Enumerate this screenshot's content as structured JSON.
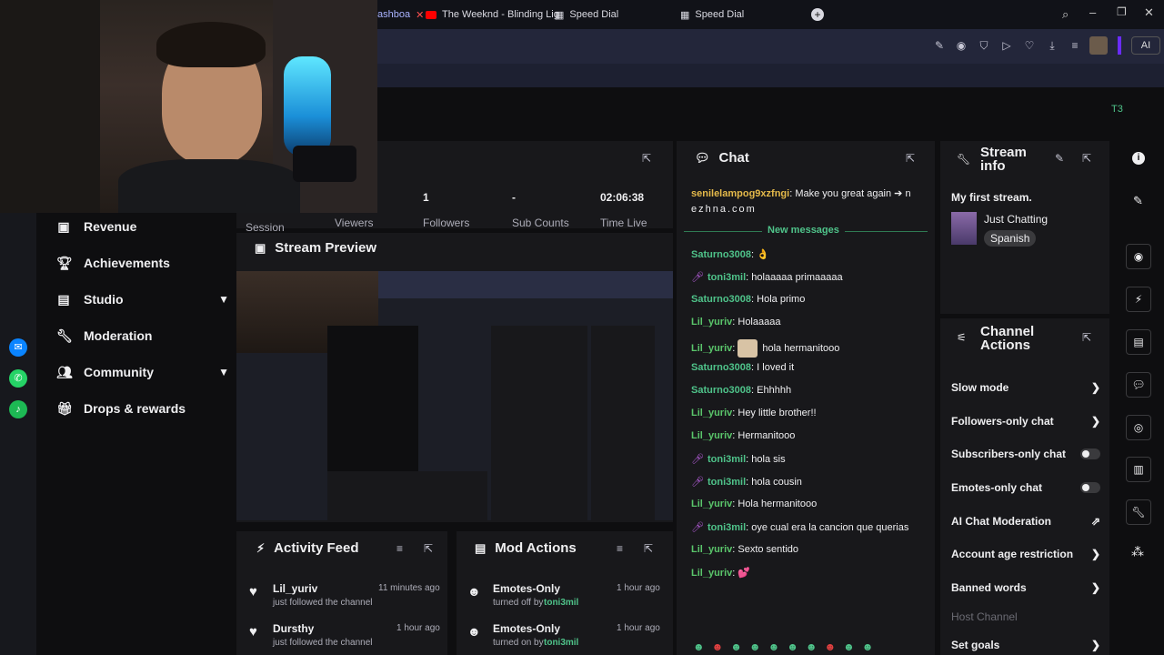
{
  "browser": {
    "tabs": [
      "ashboa",
      "The Weeknd - Blinding Lig",
      "Speed Dial",
      "Speed Dial"
    ],
    "ai_label": "AI",
    "avatar_label": "T3"
  },
  "nav": {
    "items": [
      {
        "label": "Revenue",
        "icon": "dollar-icon"
      },
      {
        "label": "Achievements",
        "icon": "trophy-icon"
      },
      {
        "label": "Studio",
        "icon": "studio-icon",
        "chevron": true
      },
      {
        "label": "Moderation",
        "icon": "wrench-icon"
      },
      {
        "label": "Community",
        "icon": "people-icon",
        "chevron": true
      },
      {
        "label": "Drops & rewards",
        "icon": "gift-icon"
      }
    ]
  },
  "stats": {
    "session_label": "Session",
    "viewers_label": "Viewers",
    "followers_value": "1",
    "followers_label": "Followers",
    "subs_value": "-",
    "subs_label": "Sub Counts",
    "time_value": "02:06:38",
    "time_label": "Time Live"
  },
  "preview": {
    "title": "Stream Preview"
  },
  "activity": {
    "title": "Activity Feed",
    "items": [
      {
        "name": "Lil_yuriv",
        "sub": "just followed the channel",
        "time": "11 minutes ago"
      },
      {
        "name": "Dursthy",
        "sub": "just followed the channel",
        "time": "1 hour ago"
      }
    ]
  },
  "mod": {
    "title": "Mod Actions",
    "items": [
      {
        "name": "Emotes-Only",
        "sub": "turned off by",
        "by": "toni3mil",
        "time": "1 hour ago"
      },
      {
        "name": "Emotes-Only",
        "sub": "turned on by",
        "by": "toni3mil",
        "time": "1 hour ago"
      }
    ]
  },
  "chat": {
    "title": "Chat",
    "first_user": "senilelampog9xzfngi",
    "first_text": "Make you great again ➔ n",
    "first_text2": "ezhna.com",
    "new_messages": "New messages",
    "lines": [
      {
        "user": "Saturno3008",
        "color": "#4fc38a",
        "text": "👌",
        "badge": false
      },
      {
        "user": "toni3mil",
        "color": "#4fc38a",
        "text": "holaaaaa primaaaaa",
        "badge": true
      },
      {
        "user": "Saturno3008",
        "color": "#4fc38a",
        "text": "Hola primo",
        "badge": false
      },
      {
        "user": "Lil_yuriv",
        "color": "#5ac66b",
        "text": "Holaaaaa",
        "badge": false
      },
      {
        "user": "Lil_yuriv",
        "color": "#5ac66b",
        "text": "hola hermanitooo",
        "badge": false,
        "emote": true
      },
      {
        "user": "Saturno3008",
        "color": "#4fc38a",
        "text": "I loved it",
        "badge": false
      },
      {
        "user": "Saturno3008",
        "color": "#4fc38a",
        "text": "Ehhhhh",
        "badge": false
      },
      {
        "user": "Lil_yuriv",
        "color": "#5ac66b",
        "text": "Hey little brother!!",
        "badge": false
      },
      {
        "user": "Lil_yuriv",
        "color": "#5ac66b",
        "text": "Hermanitooo",
        "badge": false
      },
      {
        "user": "toni3mil",
        "color": "#4fc38a",
        "text": "hola sis",
        "badge": true
      },
      {
        "user": "toni3mil",
        "color": "#4fc38a",
        "text": "hola cousin",
        "badge": true
      },
      {
        "user": "Lil_yuriv",
        "color": "#5ac66b",
        "text": "Hola hermanitooo",
        "badge": false
      },
      {
        "user": "toni3mil",
        "color": "#4fc38a",
        "text": "oye cual era la cancion que querias",
        "badge": true
      },
      {
        "user": "Lil_yuriv",
        "color": "#5ac66b",
        "text": "Sexto sentido",
        "badge": false
      },
      {
        "user": "Lil_yuriv",
        "color": "#5ac66b",
        "text": "💕",
        "badge": false
      }
    ]
  },
  "stream_info": {
    "title": "Stream info",
    "stream_title": "My first stream.",
    "category": "Just Chatting",
    "language": "Spanish"
  },
  "channel_actions": {
    "title": "Channel Actions",
    "items": [
      {
        "label": "Slow mode",
        "kind": "chevron"
      },
      {
        "label": "Followers-only chat",
        "kind": "chevron"
      },
      {
        "label": "Subscribers-only chat",
        "kind": "toggle"
      },
      {
        "label": "Emotes-only chat",
        "kind": "toggle"
      },
      {
        "label": "AI Chat Moderation",
        "kind": "external"
      },
      {
        "label": "Account age restriction",
        "kind": "chevron"
      },
      {
        "label": "Banned words",
        "kind": "chevron"
      },
      {
        "label": "Host Channel",
        "kind": "none",
        "disabled": true
      },
      {
        "label": "Set goals",
        "kind": "chevron"
      }
    ]
  },
  "colors": {
    "accent": "#9147ff",
    "green": "#4fc38a",
    "bg": "#0e0e10",
    "panel": "#18181b"
  }
}
